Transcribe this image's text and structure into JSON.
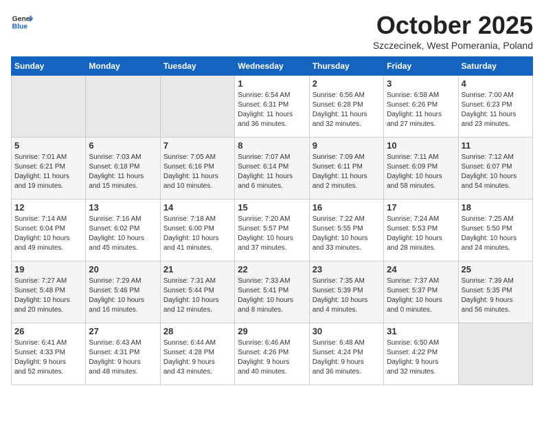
{
  "header": {
    "logo_general": "General",
    "logo_blue": "Blue",
    "title": "October 2025",
    "location": "Szczecinek, West Pomerania, Poland"
  },
  "weekdays": [
    "Sunday",
    "Monday",
    "Tuesday",
    "Wednesday",
    "Thursday",
    "Friday",
    "Saturday"
  ],
  "weeks": [
    [
      {
        "day": "",
        "info": ""
      },
      {
        "day": "",
        "info": ""
      },
      {
        "day": "",
        "info": ""
      },
      {
        "day": "1",
        "info": "Sunrise: 6:54 AM\nSunset: 6:31 PM\nDaylight: 11 hours\nand 36 minutes."
      },
      {
        "day": "2",
        "info": "Sunrise: 6:56 AM\nSunset: 6:28 PM\nDaylight: 11 hours\nand 32 minutes."
      },
      {
        "day": "3",
        "info": "Sunrise: 6:58 AM\nSunset: 6:26 PM\nDaylight: 11 hours\nand 27 minutes."
      },
      {
        "day": "4",
        "info": "Sunrise: 7:00 AM\nSunset: 6:23 PM\nDaylight: 11 hours\nand 23 minutes."
      }
    ],
    [
      {
        "day": "5",
        "info": "Sunrise: 7:01 AM\nSunset: 6:21 PM\nDaylight: 11 hours\nand 19 minutes."
      },
      {
        "day": "6",
        "info": "Sunrise: 7:03 AM\nSunset: 6:18 PM\nDaylight: 11 hours\nand 15 minutes."
      },
      {
        "day": "7",
        "info": "Sunrise: 7:05 AM\nSunset: 6:16 PM\nDaylight: 11 hours\nand 10 minutes."
      },
      {
        "day": "8",
        "info": "Sunrise: 7:07 AM\nSunset: 6:14 PM\nDaylight: 11 hours\nand 6 minutes."
      },
      {
        "day": "9",
        "info": "Sunrise: 7:09 AM\nSunset: 6:11 PM\nDaylight: 11 hours\nand 2 minutes."
      },
      {
        "day": "10",
        "info": "Sunrise: 7:11 AM\nSunset: 6:09 PM\nDaylight: 10 hours\nand 58 minutes."
      },
      {
        "day": "11",
        "info": "Sunrise: 7:12 AM\nSunset: 6:07 PM\nDaylight: 10 hours\nand 54 minutes."
      }
    ],
    [
      {
        "day": "12",
        "info": "Sunrise: 7:14 AM\nSunset: 6:04 PM\nDaylight: 10 hours\nand 49 minutes."
      },
      {
        "day": "13",
        "info": "Sunrise: 7:16 AM\nSunset: 6:02 PM\nDaylight: 10 hours\nand 45 minutes."
      },
      {
        "day": "14",
        "info": "Sunrise: 7:18 AM\nSunset: 6:00 PM\nDaylight: 10 hours\nand 41 minutes."
      },
      {
        "day": "15",
        "info": "Sunrise: 7:20 AM\nSunset: 5:57 PM\nDaylight: 10 hours\nand 37 minutes."
      },
      {
        "day": "16",
        "info": "Sunrise: 7:22 AM\nSunset: 5:55 PM\nDaylight: 10 hours\nand 33 minutes."
      },
      {
        "day": "17",
        "info": "Sunrise: 7:24 AM\nSunset: 5:53 PM\nDaylight: 10 hours\nand 28 minutes."
      },
      {
        "day": "18",
        "info": "Sunrise: 7:25 AM\nSunset: 5:50 PM\nDaylight: 10 hours\nand 24 minutes."
      }
    ],
    [
      {
        "day": "19",
        "info": "Sunrise: 7:27 AM\nSunset: 5:48 PM\nDaylight: 10 hours\nand 20 minutes."
      },
      {
        "day": "20",
        "info": "Sunrise: 7:29 AM\nSunset: 5:46 PM\nDaylight: 10 hours\nand 16 minutes."
      },
      {
        "day": "21",
        "info": "Sunrise: 7:31 AM\nSunset: 5:44 PM\nDaylight: 10 hours\nand 12 minutes."
      },
      {
        "day": "22",
        "info": "Sunrise: 7:33 AM\nSunset: 5:41 PM\nDaylight: 10 hours\nand 8 minutes."
      },
      {
        "day": "23",
        "info": "Sunrise: 7:35 AM\nSunset: 5:39 PM\nDaylight: 10 hours\nand 4 minutes."
      },
      {
        "day": "24",
        "info": "Sunrise: 7:37 AM\nSunset: 5:37 PM\nDaylight: 10 hours\nand 0 minutes."
      },
      {
        "day": "25",
        "info": "Sunrise: 7:39 AM\nSunset: 5:35 PM\nDaylight: 9 hours\nand 56 minutes."
      }
    ],
    [
      {
        "day": "26",
        "info": "Sunrise: 6:41 AM\nSunset: 4:33 PM\nDaylight: 9 hours\nand 52 minutes."
      },
      {
        "day": "27",
        "info": "Sunrise: 6:43 AM\nSunset: 4:31 PM\nDaylight: 9 hours\nand 48 minutes."
      },
      {
        "day": "28",
        "info": "Sunrise: 6:44 AM\nSunset: 4:28 PM\nDaylight: 9 hours\nand 43 minutes."
      },
      {
        "day": "29",
        "info": "Sunrise: 6:46 AM\nSunset: 4:26 PM\nDaylight: 9 hours\nand 40 minutes."
      },
      {
        "day": "30",
        "info": "Sunrise: 6:48 AM\nSunset: 4:24 PM\nDaylight: 9 hours\nand 36 minutes."
      },
      {
        "day": "31",
        "info": "Sunrise: 6:50 AM\nSunset: 4:22 PM\nDaylight: 9 hours\nand 32 minutes."
      },
      {
        "day": "",
        "info": ""
      }
    ]
  ]
}
